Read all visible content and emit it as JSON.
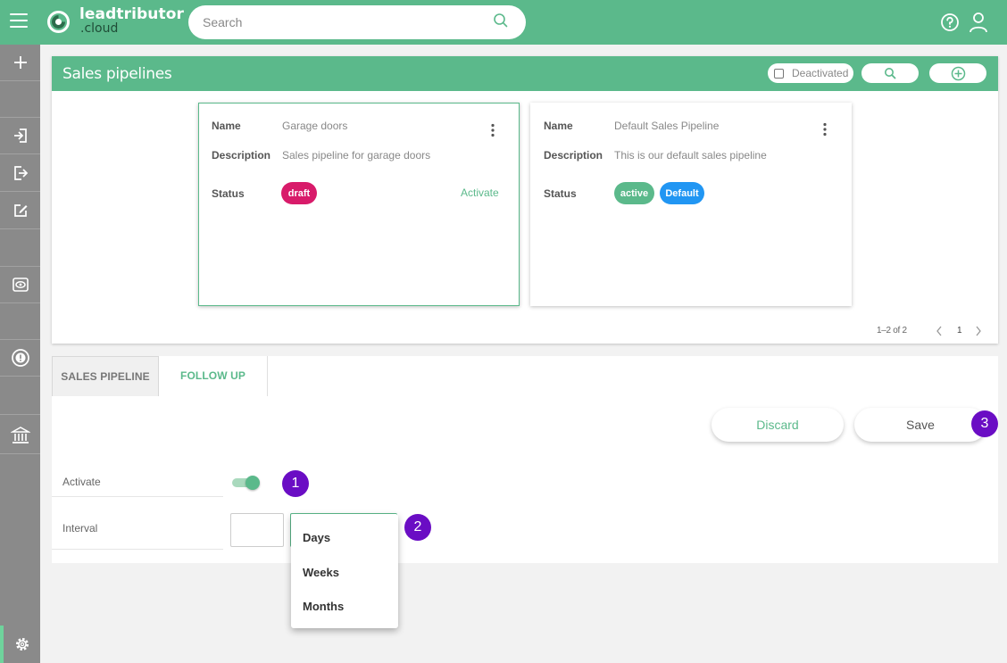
{
  "app": {
    "name": "leadtributor",
    "sub": ".cloud"
  },
  "search": {
    "placeholder": "Search",
    "value": ""
  },
  "colors": {
    "brand": "#5bb98b",
    "rail": "#8a8a8a",
    "draft": "#d81b6a",
    "active": "#5bb98b",
    "default": "#2196f3",
    "marker": "#6a0dc4"
  },
  "panel": {
    "title": "Sales pipelines",
    "deactivated_label": "Deactivated",
    "deactivated_checked": false
  },
  "pipelines": [
    {
      "name_label": "Name",
      "name": "Garage doors",
      "description_label": "Description",
      "description": "Sales pipeline for garage doors",
      "status_label": "Status",
      "status": "draft",
      "action": "Activate",
      "selected": true
    },
    {
      "name_label": "Name",
      "name": "Default Sales Pipeline",
      "description_label": "Description",
      "description": "This is our default sales pipeline",
      "status_label": "Status",
      "status": "active",
      "default_badge": "Default",
      "selected": false
    }
  ],
  "pager": {
    "range": "1–2 of 2",
    "page": "1"
  },
  "tabs": [
    {
      "label": "SALES PIPELINE",
      "active": false
    },
    {
      "label": "FOLLOW UP",
      "active": true
    }
  ],
  "actions": {
    "discard": "Discard",
    "save": "Save"
  },
  "form": {
    "activate_label": "Activate",
    "activate_on": true,
    "interval_label": "Interval",
    "interval_value": ""
  },
  "interval_options": [
    "Days",
    "Weeks",
    "Months"
  ],
  "markers": [
    "1",
    "2",
    "3"
  ],
  "rail_icons": [
    "plus-icon",
    "sign-in-icon",
    "sign-out-icon",
    "edit-icon",
    "eye-icon",
    "alert-icon",
    "bank-icon",
    "gear-icon"
  ]
}
